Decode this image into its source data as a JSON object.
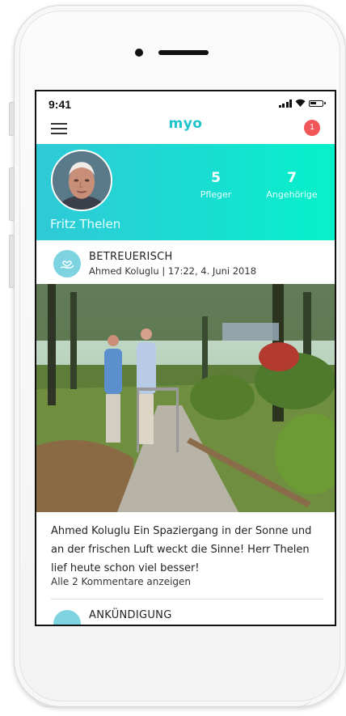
{
  "status": {
    "time": "9:41"
  },
  "app": {
    "logo": "myo",
    "notification_count": "1",
    "accent": "#1fc3ca",
    "notification_color": "#f05557"
  },
  "profile": {
    "name": "Fritz Thelen",
    "stats": [
      {
        "value": "5",
        "label": "Pfleger"
      },
      {
        "value": "7",
        "label": "Angehörige"
      }
    ],
    "gradient": [
      "#30c9d6",
      "#06f1c9"
    ]
  },
  "post": {
    "category": "BETREUERISCH",
    "category_icon": "heart-hand-icon",
    "meta": "Ahmed Koluglu | 17:22, 4. Juni 2018",
    "author": "Ahmed Koluglu",
    "text": " Ein Spaziergang in der Sonne und an der frischen Luft weckt die Sinne! Herr Thelen lief heute schon viel besser!",
    "comments_link": "Alle 2 Kommentare anzeigen"
  },
  "next_post": {
    "category": "ANKÜNDIGUNG",
    "category_icon": "megaphone-icon"
  }
}
